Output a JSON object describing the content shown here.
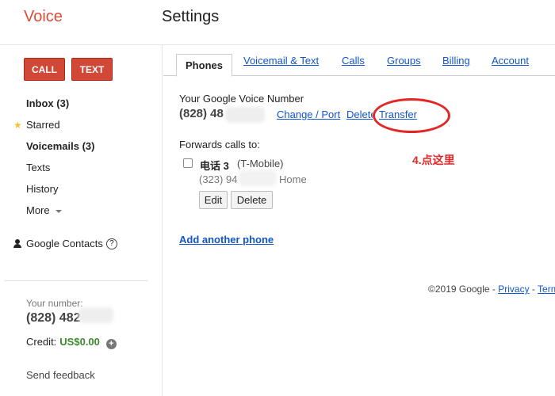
{
  "app": {
    "name": "Voice",
    "page_title": "Settings"
  },
  "sidebar": {
    "call_label": "CALL",
    "text_label": "TEXT",
    "items": [
      {
        "label": "Inbox (3)",
        "bold": true
      },
      {
        "label": "Starred"
      },
      {
        "label": "Voicemails (3)",
        "bold": true
      },
      {
        "label": "Texts"
      },
      {
        "label": "History"
      },
      {
        "label": "More"
      }
    ],
    "contacts_label": "Google Contacts",
    "help_glyph": "?",
    "your_number_label": "Your number:",
    "your_number": "(828) 482",
    "credit_label": "Credit:",
    "credit_amount": "US$0.00",
    "send_feedback": "Send feedback"
  },
  "tabs": [
    {
      "label": "Phones",
      "active": true
    },
    {
      "label": "Voicemail & Text"
    },
    {
      "label": "Calls"
    },
    {
      "label": "Groups"
    },
    {
      "label": "Billing"
    },
    {
      "label": "Account"
    }
  ],
  "phones": {
    "gv_label": "Your Google Voice Number",
    "gv_number": "(828) 48",
    "change_port": "Change / Port",
    "delete": "Delete",
    "transfer": "Transfer",
    "forwards_label": "Forwards calls to:",
    "forward_phone": {
      "name": "电话 3",
      "carrier": "(T-Mobile)",
      "number": "(323) 94",
      "type": "Home",
      "edit_label": "Edit",
      "delete_label": "Delete"
    },
    "add_phone": "Add another phone"
  },
  "annotation": {
    "text": "4.点这里",
    "color": "#e32626"
  },
  "footer": {
    "copyright": "©2019 Google - ",
    "privacy": "Privacy",
    "sep": " - ",
    "terms": "Terms"
  },
  "colors": {
    "brand_red": "#dd4b39",
    "button_red": "#d14836",
    "link_blue": "#1155cc",
    "credit_green": "#3c8a2e"
  }
}
